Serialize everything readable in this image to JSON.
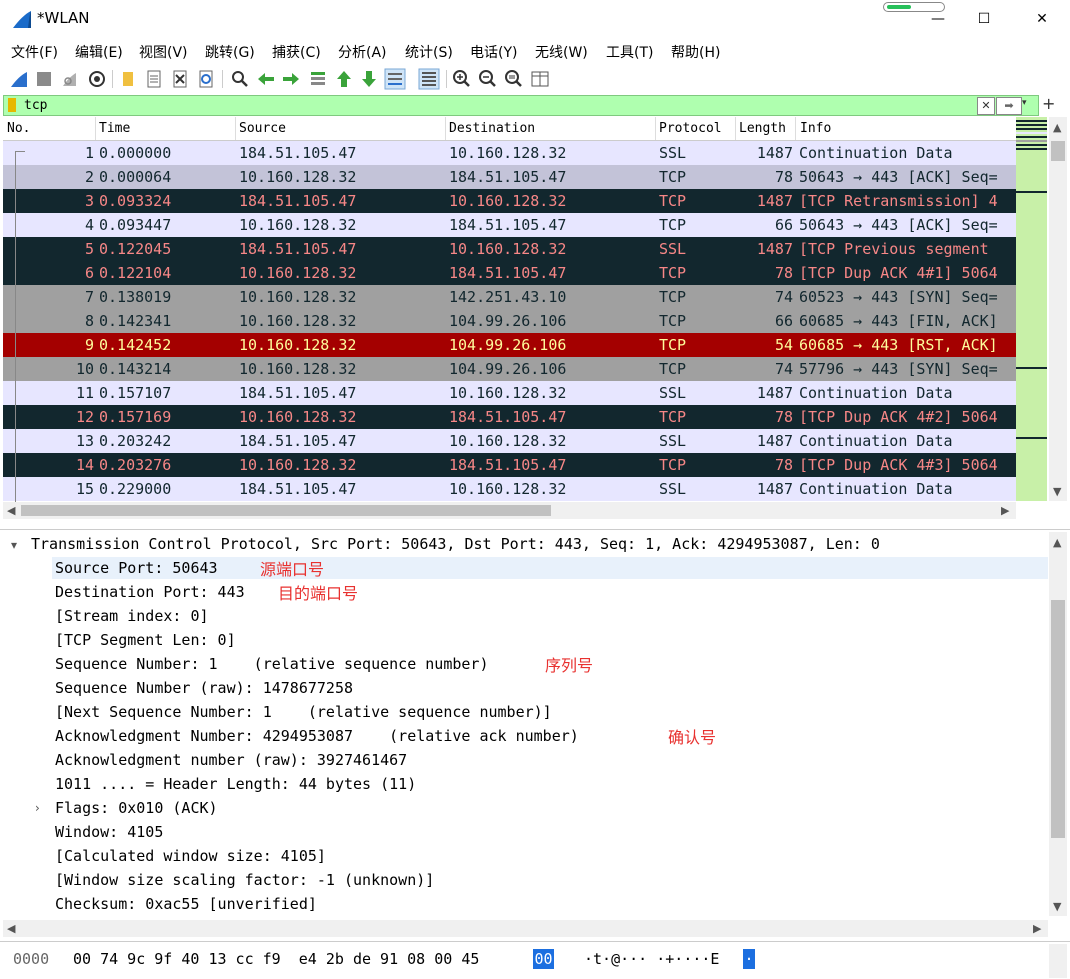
{
  "window": {
    "title": "*WLAN",
    "minimize": "—",
    "maximize": "☐",
    "close": "✕"
  },
  "capture_progress": 0.45,
  "menu": [
    "文件(F)",
    "编辑(E)",
    "视图(V)",
    "跳转(G)",
    "捕获(C)",
    "分析(A)",
    "统计(S)",
    "电话(Y)",
    "无线(W)",
    "工具(T)",
    "帮助(H)"
  ],
  "toolbar_icons": [
    "start-capture-icon",
    "stop-capture-icon",
    "restart-capture-icon",
    "capture-options-icon",
    "open-file-icon",
    "save-file-icon",
    "close-file-icon",
    "reload-file-icon",
    "find-packet-icon",
    "go-back-icon",
    "go-forward-icon",
    "go-to-packet-icon",
    "go-first-icon",
    "go-last-icon",
    "autoscroll-icon",
    "colorize-icon",
    "zoom-in-icon",
    "zoom-out-icon",
    "zoom-normal-icon",
    "resize-columns-icon"
  ],
  "filter": {
    "value": "tcp",
    "clear": "✕",
    "apply": "➡",
    "dropdown": "▾",
    "add": "+"
  },
  "columns": [
    "No.",
    "Time",
    "Source",
    "Destination",
    "Protocol",
    "Length",
    "Info"
  ],
  "colors": {
    "light_row_bg": "#e7e6ff",
    "light_row_fg": "#12272e",
    "selected_row_bg": "#c3c3d8",
    "bad_row_bg": "#12272e",
    "bad_row_fg": "#f78787",
    "gray_row_bg": "#a0a0a0",
    "gray_row_fg": "#12272e",
    "rst_row_bg": "#a40000",
    "rst_row_fg": "#fffc9c",
    "annotation": "#e8312f"
  },
  "packets": [
    {
      "no": "1",
      "time": "0.000000",
      "src": "184.51.105.47",
      "dst": "10.160.128.32",
      "proto": "SSL",
      "len": "1487",
      "info": "Continuation Data",
      "style": "light"
    },
    {
      "no": "2",
      "time": "0.000064",
      "src": "10.160.128.32",
      "dst": "184.51.105.47",
      "proto": "TCP",
      "len": "78",
      "info": "50643 → 443 [ACK] Seq=",
      "style": "selected"
    },
    {
      "no": "3",
      "time": "0.093324",
      "src": "184.51.105.47",
      "dst": "10.160.128.32",
      "proto": "TCP",
      "len": "1487",
      "info": "[TCP Retransmission] 4",
      "style": "bad"
    },
    {
      "no": "4",
      "time": "0.093447",
      "src": "10.160.128.32",
      "dst": "184.51.105.47",
      "proto": "TCP",
      "len": "66",
      "info": "50643 → 443 [ACK] Seq=",
      "style": "light"
    },
    {
      "no": "5",
      "time": "0.122045",
      "src": "184.51.105.47",
      "dst": "10.160.128.32",
      "proto": "SSL",
      "len": "1487",
      "info": "[TCP Previous segment",
      "style": "bad"
    },
    {
      "no": "6",
      "time": "0.122104",
      "src": "10.160.128.32",
      "dst": "184.51.105.47",
      "proto": "TCP",
      "len": "78",
      "info": "[TCP Dup ACK 4#1] 5064",
      "style": "bad"
    },
    {
      "no": "7",
      "time": "0.138019",
      "src": "10.160.128.32",
      "dst": "142.251.43.10",
      "proto": "TCP",
      "len": "74",
      "info": "60523 → 443 [SYN] Seq=",
      "style": "gray"
    },
    {
      "no": "8",
      "time": "0.142341",
      "src": "10.160.128.32",
      "dst": "104.99.26.106",
      "proto": "TCP",
      "len": "66",
      "info": "60685 → 443 [FIN, ACK]",
      "style": "gray"
    },
    {
      "no": "9",
      "time": "0.142452",
      "src": "10.160.128.32",
      "dst": "104.99.26.106",
      "proto": "TCP",
      "len": "54",
      "info": "60685 → 443 [RST, ACK]",
      "style": "rst"
    },
    {
      "no": "10",
      "time": "0.143214",
      "src": "10.160.128.32",
      "dst": "104.99.26.106",
      "proto": "TCP",
      "len": "74",
      "info": "57796 → 443 [SYN] Seq=",
      "style": "gray"
    },
    {
      "no": "11",
      "time": "0.157107",
      "src": "184.51.105.47",
      "dst": "10.160.128.32",
      "proto": "SSL",
      "len": "1487",
      "info": "Continuation Data",
      "style": "light"
    },
    {
      "no": "12",
      "time": "0.157169",
      "src": "10.160.128.32",
      "dst": "184.51.105.47",
      "proto": "TCP",
      "len": "78",
      "info": "[TCP Dup ACK 4#2] 5064",
      "style": "bad"
    },
    {
      "no": "13",
      "time": "0.203242",
      "src": "184.51.105.47",
      "dst": "10.160.128.32",
      "proto": "SSL",
      "len": "1487",
      "info": "Continuation Data",
      "style": "light"
    },
    {
      "no": "14",
      "time": "0.203276",
      "src": "10.160.128.32",
      "dst": "184.51.105.47",
      "proto": "TCP",
      "len": "78",
      "info": "[TCP Dup ACK 4#3] 5064",
      "style": "bad"
    },
    {
      "no": "15",
      "time": "0.229000",
      "src": "184.51.105.47",
      "dst": "10.160.128.32",
      "proto": "SSL",
      "len": "1487",
      "info": "Continuation Data",
      "style": "light"
    }
  ],
  "details": {
    "header": "Transmission Control Protocol, Src Port: 50643, Dst Port: 443, Seq: 1, Ack: 4294953087, Len: 0",
    "fields": [
      "Source Port: 50643",
      "Destination Port: 443",
      "[Stream index: 0]",
      "[TCP Segment Len: 0]",
      "Sequence Number: 1    (relative sequence number)",
      "Sequence Number (raw): 1478677258",
      "[Next Sequence Number: 1    (relative sequence number)]",
      "Acknowledgment Number: 4294953087    (relative ack number)",
      "Acknowledgment number (raw): 3927461467",
      "1011 .... = Header Length: 44 bytes (11)",
      "Flags: 0x010 (ACK)",
      "Window: 4105",
      "[Calculated window size: 4105]",
      "[Window size scaling factor: -1 (unknown)]",
      "Checksum: 0xac55 [unverified]"
    ],
    "annotations": {
      "source_port": "源端口号",
      "destination_port": "目的端口号",
      "sequence_number": "序列号",
      "ack_number": "确认号"
    }
  },
  "bytes": {
    "offset": "0000",
    "hex": "00 74 9c 9f 40 13 cc f9  e4 2b de 91 08 00 45",
    "hex_selected": "00",
    "ascii": "·t·@··· ·+····E",
    "ascii_selected": "·"
  }
}
